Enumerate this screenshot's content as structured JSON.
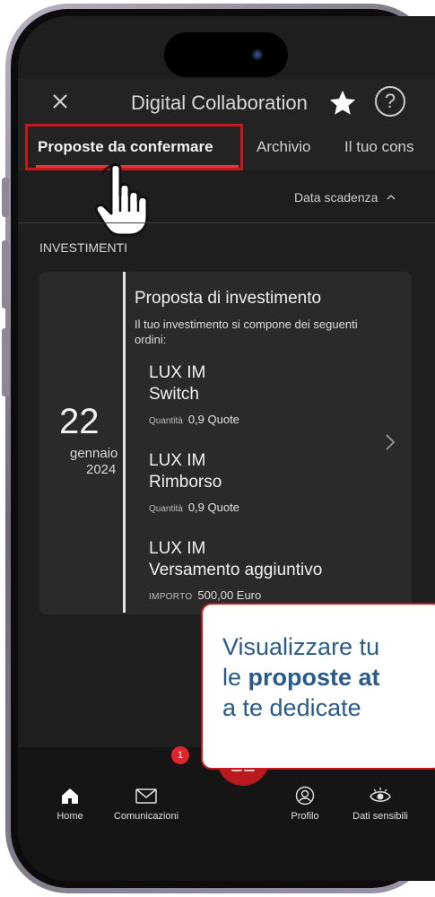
{
  "header": {
    "title": "Digital Collaboration"
  },
  "tabs": [
    {
      "label": "Proposte da confermare",
      "active": true
    },
    {
      "label": "Archivio",
      "active": false
    },
    {
      "label": "Il tuo cons",
      "active": false
    }
  ],
  "sort": {
    "label": "Data scadenza"
  },
  "section": {
    "label": "INVESTIMENTI"
  },
  "proposal": {
    "date": {
      "day": "22",
      "month": "gennaio",
      "year": "2024"
    },
    "title": "Proposta di investimento",
    "description": "Il tuo investimento si compone dei seguenti ordini:",
    "orders": [
      {
        "fund": "LUX IM",
        "type": "Switch",
        "meta_label": "Quantità",
        "meta_value": "0,9 Quote"
      },
      {
        "fund": "LUX IM",
        "type": "Rimborso",
        "meta_label": "Quantità",
        "meta_value": "0,9 Quote"
      },
      {
        "fund": "LUX IM",
        "type": "Versamento aggiuntivo",
        "meta_label": "IMPORTO",
        "meta_value": "500,00 Euro"
      }
    ]
  },
  "callout": {
    "line1": "Visualizzare tu",
    "line2_prefix": "le ",
    "line2_bold": "proposte at",
    "line3": "a te dedicate"
  },
  "bottom_nav": {
    "items": [
      {
        "label": "Home",
        "icon": "home-icon"
      },
      {
        "label": "Comunicazioni",
        "icon": "mail-icon",
        "badge": "1"
      },
      {
        "label": "",
        "icon": "grid-menu-icon"
      },
      {
        "label": "Profilo",
        "icon": "profile-icon"
      },
      {
        "label": "Dati sensibili",
        "icon": "eye-icon"
      }
    ]
  },
  "colors": {
    "accent_red": "#c8161d",
    "background": "#1e1e1f",
    "callout_text": "#2a5a8a"
  }
}
